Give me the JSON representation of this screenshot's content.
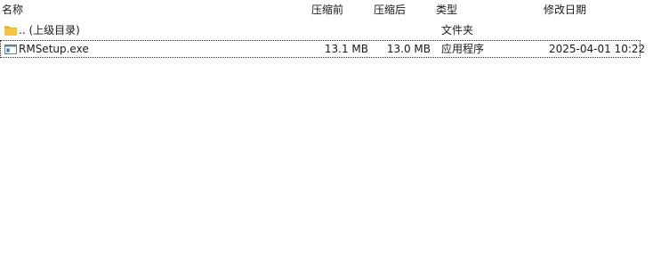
{
  "columns": {
    "name": "名称",
    "packed": "压缩前",
    "compressed": "压缩后",
    "type": "类型",
    "modified": "修改日期"
  },
  "rows": [
    {
      "name": ".. (上级目录)",
      "packed": "",
      "compressed": "",
      "type": "文件夹",
      "modified": "",
      "icon": "folder-icon"
    },
    {
      "name": "RMSetup.exe",
      "packed": "13.1 MB",
      "compressed": "13.0 MB",
      "type": "应用程序",
      "modified": "2025-04-01 10:22",
      "icon": "exe-file-icon"
    }
  ],
  "colors": {
    "folder": "#f5c542",
    "folder_dark": "#e0a820",
    "exe_border": "#6b7b8f",
    "exe_accent": "#1f6fd1"
  }
}
